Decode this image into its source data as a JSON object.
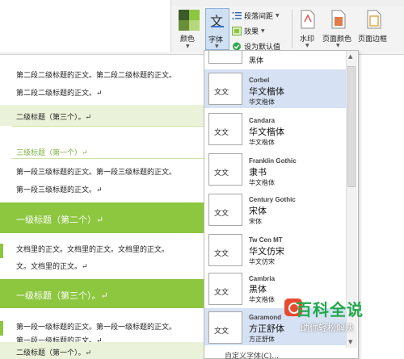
{
  "ribbon": {
    "color_label": "颜色",
    "font_label": "字体",
    "font_glyph": "文",
    "para_spacing_label": "段落间距",
    "effects_label": "效果",
    "set_default_label": "设为默认值",
    "watermark_label": "水印",
    "page_color_label": "页面颜色",
    "page_border_label": "页面边框",
    "swatch_colors": [
      "#3d5a2a",
      "#8dc63f",
      "#6a8f3a",
      "#b6d77a"
    ]
  },
  "document": {
    "lines": [
      "第二段二级标题的正文。第二段二级标题的正文。",
      "第二段二级标题的正文。↵",
      "二级标题（第三个）。↵",
      "三级标题（第一个）↵",
      "第一段三级标题的正文。第一段三级标题的正文。",
      "第一段三级标题的正文。↵",
      "一级标题（第二个）↵",
      "文档里的正文。文档里的正文。文档里的正文。",
      "文。文档里的正文。↵",
      "一级标题（第三个）。↵",
      "第一段一级标题的正文。第一段一级标题的正文。",
      "第一段一级标题的正文。↵",
      "二级标题（第一个）。↵"
    ]
  },
  "font_menu": {
    "first_partial": "黑体",
    "items": [
      {
        "thumb": "文文",
        "theme": "Corbel",
        "major": "华文楷体",
        "minor": "华文楷体",
        "selected": true
      },
      {
        "thumb": "文文",
        "theme": "Candara",
        "major": "华文楷体",
        "minor": "华文楷体",
        "selected": false
      },
      {
        "thumb": "文文",
        "theme": "Franklin Gothic",
        "major": "隶书",
        "minor": "华文楷体",
        "selected": false
      },
      {
        "thumb": "文文",
        "theme": "Century Gothic",
        "major": "宋体",
        "minor": "宋体",
        "selected": false
      },
      {
        "thumb": "文文",
        "theme": "Tw Cen MT",
        "major": "华文仿宋",
        "minor": "华文仿宋",
        "selected": false
      },
      {
        "thumb": "文文",
        "theme": "Cambria",
        "major": "黑体",
        "minor": "华文楷体",
        "selected": false
      },
      {
        "thumb": "文文",
        "theme": "Garamond",
        "major": "方正舒体",
        "minor": "方正舒体",
        "selected": true
      }
    ],
    "custom_label": "自定义字体(C)..."
  },
  "watermark": {
    "title": "百科全说",
    "subtitle": "助你轻松解决"
  }
}
